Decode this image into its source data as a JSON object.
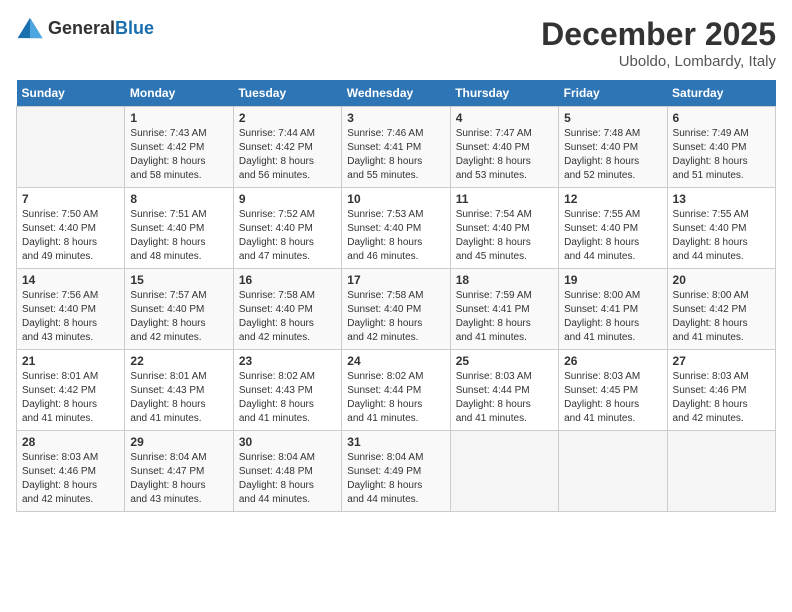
{
  "header": {
    "logo_general": "General",
    "logo_blue": "Blue",
    "month_title": "December 2025",
    "location": "Uboldo, Lombardy, Italy"
  },
  "weekdays": [
    "Sunday",
    "Monday",
    "Tuesday",
    "Wednesday",
    "Thursday",
    "Friday",
    "Saturday"
  ],
  "weeks": [
    [
      {
        "day": "",
        "info": ""
      },
      {
        "day": "1",
        "info": "Sunrise: 7:43 AM\nSunset: 4:42 PM\nDaylight: 8 hours\nand 58 minutes."
      },
      {
        "day": "2",
        "info": "Sunrise: 7:44 AM\nSunset: 4:42 PM\nDaylight: 8 hours\nand 56 minutes."
      },
      {
        "day": "3",
        "info": "Sunrise: 7:46 AM\nSunset: 4:41 PM\nDaylight: 8 hours\nand 55 minutes."
      },
      {
        "day": "4",
        "info": "Sunrise: 7:47 AM\nSunset: 4:40 PM\nDaylight: 8 hours\nand 53 minutes."
      },
      {
        "day": "5",
        "info": "Sunrise: 7:48 AM\nSunset: 4:40 PM\nDaylight: 8 hours\nand 52 minutes."
      },
      {
        "day": "6",
        "info": "Sunrise: 7:49 AM\nSunset: 4:40 PM\nDaylight: 8 hours\nand 51 minutes."
      }
    ],
    [
      {
        "day": "7",
        "info": "Sunrise: 7:50 AM\nSunset: 4:40 PM\nDaylight: 8 hours\nand 49 minutes."
      },
      {
        "day": "8",
        "info": "Sunrise: 7:51 AM\nSunset: 4:40 PM\nDaylight: 8 hours\nand 48 minutes."
      },
      {
        "day": "9",
        "info": "Sunrise: 7:52 AM\nSunset: 4:40 PM\nDaylight: 8 hours\nand 47 minutes."
      },
      {
        "day": "10",
        "info": "Sunrise: 7:53 AM\nSunset: 4:40 PM\nDaylight: 8 hours\nand 46 minutes."
      },
      {
        "day": "11",
        "info": "Sunrise: 7:54 AM\nSunset: 4:40 PM\nDaylight: 8 hours\nand 45 minutes."
      },
      {
        "day": "12",
        "info": "Sunrise: 7:55 AM\nSunset: 4:40 PM\nDaylight: 8 hours\nand 44 minutes."
      },
      {
        "day": "13",
        "info": "Sunrise: 7:55 AM\nSunset: 4:40 PM\nDaylight: 8 hours\nand 44 minutes."
      }
    ],
    [
      {
        "day": "14",
        "info": "Sunrise: 7:56 AM\nSunset: 4:40 PM\nDaylight: 8 hours\nand 43 minutes."
      },
      {
        "day": "15",
        "info": "Sunrise: 7:57 AM\nSunset: 4:40 PM\nDaylight: 8 hours\nand 42 minutes."
      },
      {
        "day": "16",
        "info": "Sunrise: 7:58 AM\nSunset: 4:40 PM\nDaylight: 8 hours\nand 42 minutes."
      },
      {
        "day": "17",
        "info": "Sunrise: 7:58 AM\nSunset: 4:40 PM\nDaylight: 8 hours\nand 42 minutes."
      },
      {
        "day": "18",
        "info": "Sunrise: 7:59 AM\nSunset: 4:41 PM\nDaylight: 8 hours\nand 41 minutes."
      },
      {
        "day": "19",
        "info": "Sunrise: 8:00 AM\nSunset: 4:41 PM\nDaylight: 8 hours\nand 41 minutes."
      },
      {
        "day": "20",
        "info": "Sunrise: 8:00 AM\nSunset: 4:42 PM\nDaylight: 8 hours\nand 41 minutes."
      }
    ],
    [
      {
        "day": "21",
        "info": "Sunrise: 8:01 AM\nSunset: 4:42 PM\nDaylight: 8 hours\nand 41 minutes."
      },
      {
        "day": "22",
        "info": "Sunrise: 8:01 AM\nSunset: 4:43 PM\nDaylight: 8 hours\nand 41 minutes."
      },
      {
        "day": "23",
        "info": "Sunrise: 8:02 AM\nSunset: 4:43 PM\nDaylight: 8 hours\nand 41 minutes."
      },
      {
        "day": "24",
        "info": "Sunrise: 8:02 AM\nSunset: 4:44 PM\nDaylight: 8 hours\nand 41 minutes."
      },
      {
        "day": "25",
        "info": "Sunrise: 8:03 AM\nSunset: 4:44 PM\nDaylight: 8 hours\nand 41 minutes."
      },
      {
        "day": "26",
        "info": "Sunrise: 8:03 AM\nSunset: 4:45 PM\nDaylight: 8 hours\nand 41 minutes."
      },
      {
        "day": "27",
        "info": "Sunrise: 8:03 AM\nSunset: 4:46 PM\nDaylight: 8 hours\nand 42 minutes."
      }
    ],
    [
      {
        "day": "28",
        "info": "Sunrise: 8:03 AM\nSunset: 4:46 PM\nDaylight: 8 hours\nand 42 minutes."
      },
      {
        "day": "29",
        "info": "Sunrise: 8:04 AM\nSunset: 4:47 PM\nDaylight: 8 hours\nand 43 minutes."
      },
      {
        "day": "30",
        "info": "Sunrise: 8:04 AM\nSunset: 4:48 PM\nDaylight: 8 hours\nand 44 minutes."
      },
      {
        "day": "31",
        "info": "Sunrise: 8:04 AM\nSunset: 4:49 PM\nDaylight: 8 hours\nand 44 minutes."
      },
      {
        "day": "",
        "info": ""
      },
      {
        "day": "",
        "info": ""
      },
      {
        "day": "",
        "info": ""
      }
    ]
  ]
}
